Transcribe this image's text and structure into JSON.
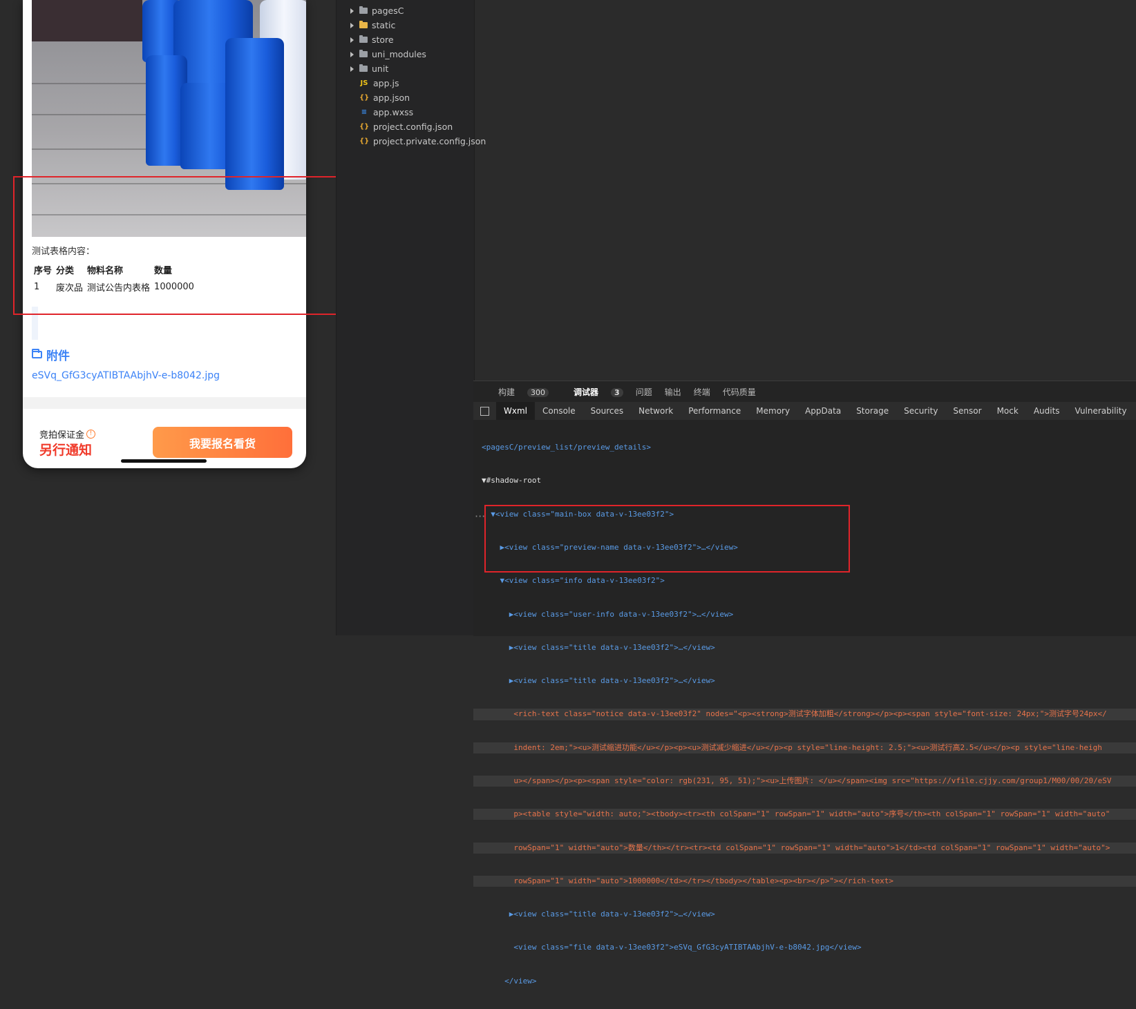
{
  "simulator": {
    "table_label": "测试表格内容：",
    "table": {
      "headers": [
        "序号",
        "分类",
        "物料名称",
        "数量"
      ],
      "rows": [
        [
          "1",
          "废次品",
          "测试公告内表格",
          "1000000"
        ]
      ]
    },
    "attachment_title": "附件",
    "attachment_file": "eSVq_GfG3cyATIBTAAbjhV-e-b8042.jpg",
    "deposit_label": "竞拍保证金",
    "deposit_value": "另行通知",
    "apply_button": "我要报名看货"
  },
  "file_tree": [
    {
      "name": "pagesC",
      "type": "folder",
      "icon": "folder-icon"
    },
    {
      "name": "static",
      "type": "folder",
      "icon": "folder-yellow-icon"
    },
    {
      "name": "store",
      "type": "folder",
      "icon": "folder-icon"
    },
    {
      "name": "uni_modules",
      "type": "folder",
      "icon": "folder-icon"
    },
    {
      "name": "unit",
      "type": "folder",
      "icon": "folder-icon"
    },
    {
      "name": "app.js",
      "type": "file",
      "icon": "js-file-icon"
    },
    {
      "name": "app.json",
      "type": "file",
      "icon": "json-file-icon"
    },
    {
      "name": "app.wxss",
      "type": "file",
      "icon": "wxss-file-icon"
    },
    {
      "name": "project.config.json",
      "type": "file",
      "icon": "json-file-icon"
    },
    {
      "name": "project.private.config.json",
      "type": "file",
      "icon": "json-file-icon"
    }
  ],
  "devtools": {
    "top_tabs": [
      {
        "label": "构建",
        "badge": "300"
      },
      {
        "label": "调试器",
        "badge": "3"
      },
      {
        "label": "问题"
      },
      {
        "label": "输出"
      },
      {
        "label": "终端"
      },
      {
        "label": "代码质量"
      }
    ],
    "panel_tabs": [
      "Wxml",
      "Console",
      "Sources",
      "Network",
      "Performance",
      "Memory",
      "AppData",
      "Storage",
      "Security",
      "Sensor",
      "Mock",
      "Audits",
      "Vulnerability"
    ],
    "active_panel": "Wxml",
    "code_lines": [
      "<pagesC/preview_list/preview_details>",
      "▼#shadow-root",
      "  ▼<view class=\"main-box data-v-13ee03f2\">",
      "    ▶<view class=\"preview-name data-v-13ee03f2\">…</view>",
      "    ▼<view class=\"info data-v-13ee03f2\">",
      "      ▶<view class=\"user-info data-v-13ee03f2\">…</view>",
      "      ▶<view class=\"title data-v-13ee03f2\">…</view>",
      "      ▶<view class=\"title data-v-13ee03f2\">…</view>",
      "       <rich-text class=\"notice data-v-13ee03f2\" nodes=\"<p><strong>测试字体加粗</strong></p><p><span style=\"font-size: 24px;\">测试字号24px</",
      "       indent: 2em;\"><u>测试缩进功能</u></p><p><u>测试减少缩进</u></p><p style=\"line-height: 2.5;\"><u>测试行高2.5</u></p><p style=\"line-heigh",
      "       u></span></p><p><span style=\"color: rgb(231, 95, 51);\"><u>上传图片: </u></span><img src=\"https://vfile.cjjy.com/group1/M00/00/20/eSV",
      "       p><table style=\"width: auto;\"><tbody><tr><th colSpan=\"1\" rowSpan=\"1\" width=\"auto\">序号</th><th colSpan=\"1\" rowSpan=\"1\" width=\"auto\"",
      "       rowSpan=\"1\" width=\"auto\">数量</th></tr><tr><td colSpan=\"1\" rowSpan=\"1\" width=\"auto\">1</td><td colSpan=\"1\" rowSpan=\"1\" width=\"auto\">",
      "       rowSpan=\"1\" width=\"auto\">1000000</td></tr></tbody></table><p><br></p>\"></rich-text>",
      "      ▶<view class=\"title data-v-13ee03f2\">…</view>",
      "       <view class=\"file data-v-13ee03f2\">eSVq_GfG3cyATIBTAAbjhV-e-b8042.jpg</view>",
      "     </view>"
    ]
  },
  "colors": {
    "accent_blue": "#3b82f6",
    "notice_red": "#f03a2a",
    "button_orange": "#ff7a3a",
    "annotation_red": "#e0242a"
  }
}
